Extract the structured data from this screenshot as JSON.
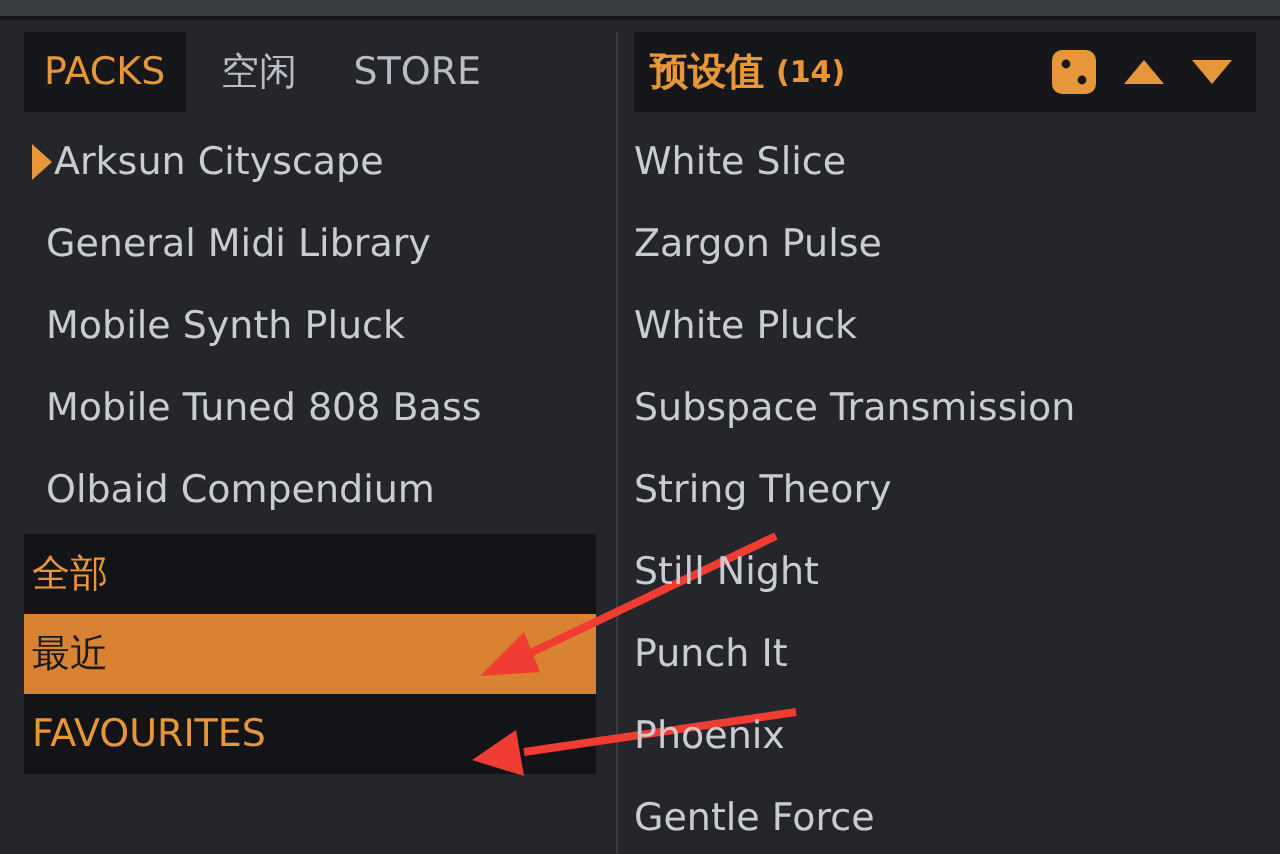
{
  "tabs": [
    {
      "label": "PACKS",
      "selected": true
    },
    {
      "label": "空闲",
      "selected": false
    },
    {
      "label": "STORE",
      "selected": false
    }
  ],
  "presets_header": {
    "title": "预设值",
    "count": "(14)"
  },
  "packs": [
    {
      "name": "Arksun Cityscape",
      "selected": true
    },
    {
      "name": "General Midi Library",
      "selected": false
    },
    {
      "name": "Mobile Synth Pluck",
      "selected": false
    },
    {
      "name": "Mobile Tuned 808 Bass",
      "selected": false
    },
    {
      "name": "Olbaid Compendium",
      "selected": false
    }
  ],
  "categories": [
    {
      "label": "全部",
      "selected": false
    },
    {
      "label": "最近",
      "selected": true
    },
    {
      "label": "FAVOURITES",
      "selected": false
    }
  ],
  "presets": [
    "White Slice",
    "Zargon Pulse",
    "White Pluck",
    "Subspace Transmission",
    "String Theory",
    "Still Night",
    "Punch It",
    "Phoenix",
    "Gentle Force"
  ]
}
